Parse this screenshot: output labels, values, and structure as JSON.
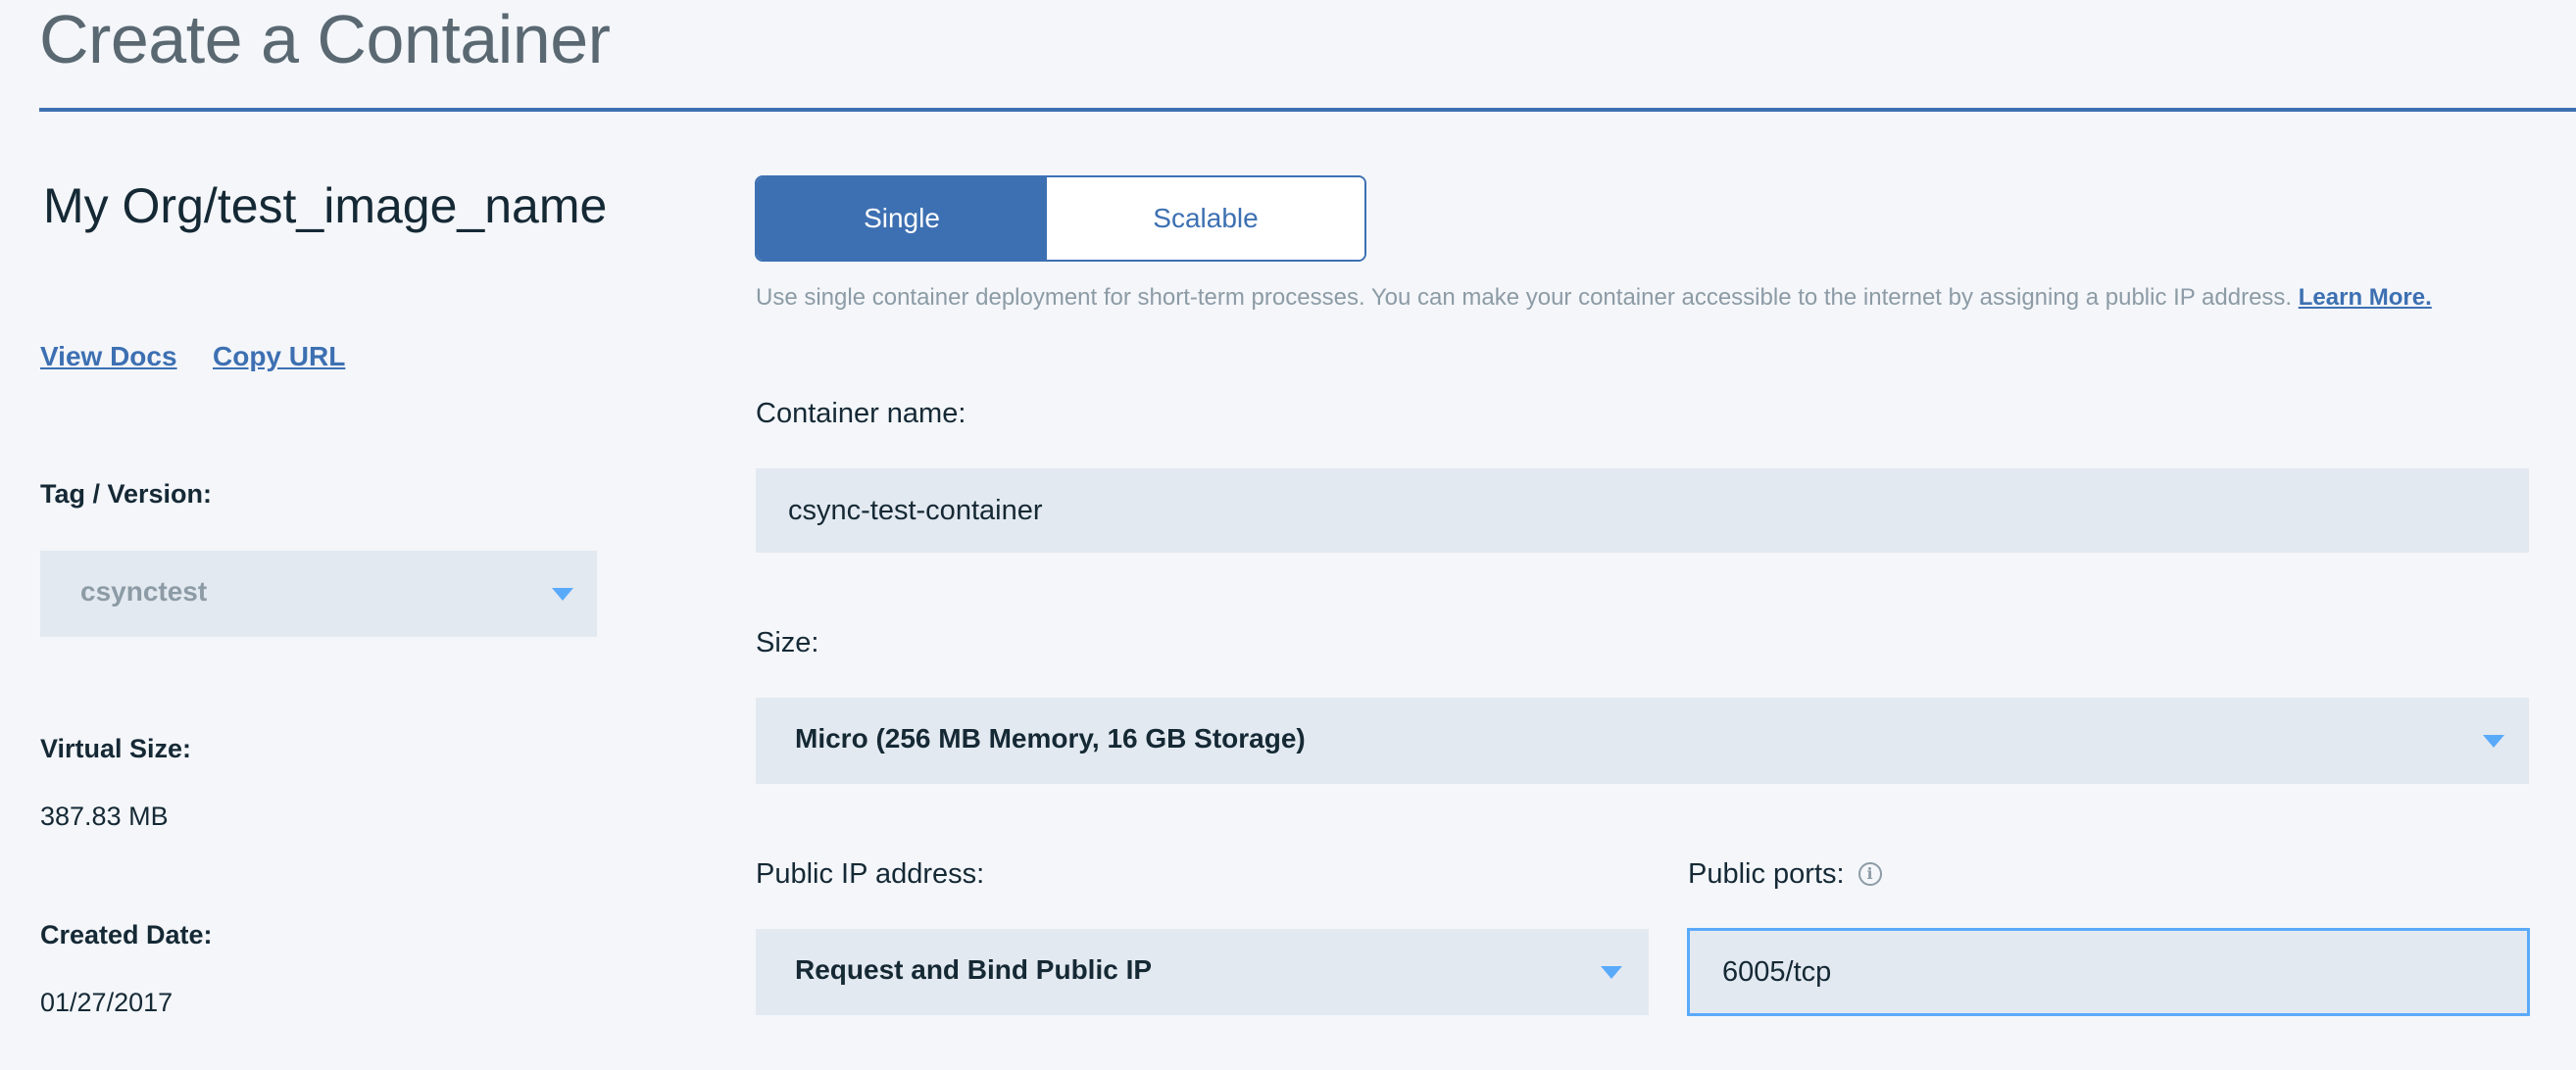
{
  "page": {
    "title": "Create a Container"
  },
  "image": {
    "org": "My Org",
    "separator": "/",
    "name": "test_image_name"
  },
  "links": {
    "view_docs": "View Docs",
    "copy_url": "Copy URL"
  },
  "details": {
    "tag_label": "Tag / Version:",
    "tag_value": "csynctest",
    "virtual_size_label": "Virtual Size:",
    "virtual_size_value": "387.83 MB",
    "created_date_label": "Created Date:",
    "created_date_value": "01/27/2017"
  },
  "deployment": {
    "options": [
      "Single",
      "Scalable"
    ],
    "selected": "Single",
    "help_text": "Use single container deployment for short-term processes. You can make your container accessible to the internet by assigning a public IP address.",
    "learn_more": "Learn More."
  },
  "form": {
    "container_name_label": "Container name:",
    "container_name_value": "csync-test-container",
    "size_label": "Size:",
    "size_value": "Micro (256 MB Memory, 16 GB Storage)",
    "public_ip_label": "Public IP address:",
    "public_ip_value": "Request and Bind Public IP",
    "public_ports_label": "Public ports:",
    "public_ports_value": "6005/tcp"
  },
  "icons": {
    "dropdown": "chevron-down-icon",
    "info": "info-icon"
  },
  "colors": {
    "accent": "#3d70b2",
    "focus": "#5aaafa",
    "background": "#f4f6fa",
    "field": "#e3e9f0",
    "muted_text": "#8c9ba5"
  }
}
